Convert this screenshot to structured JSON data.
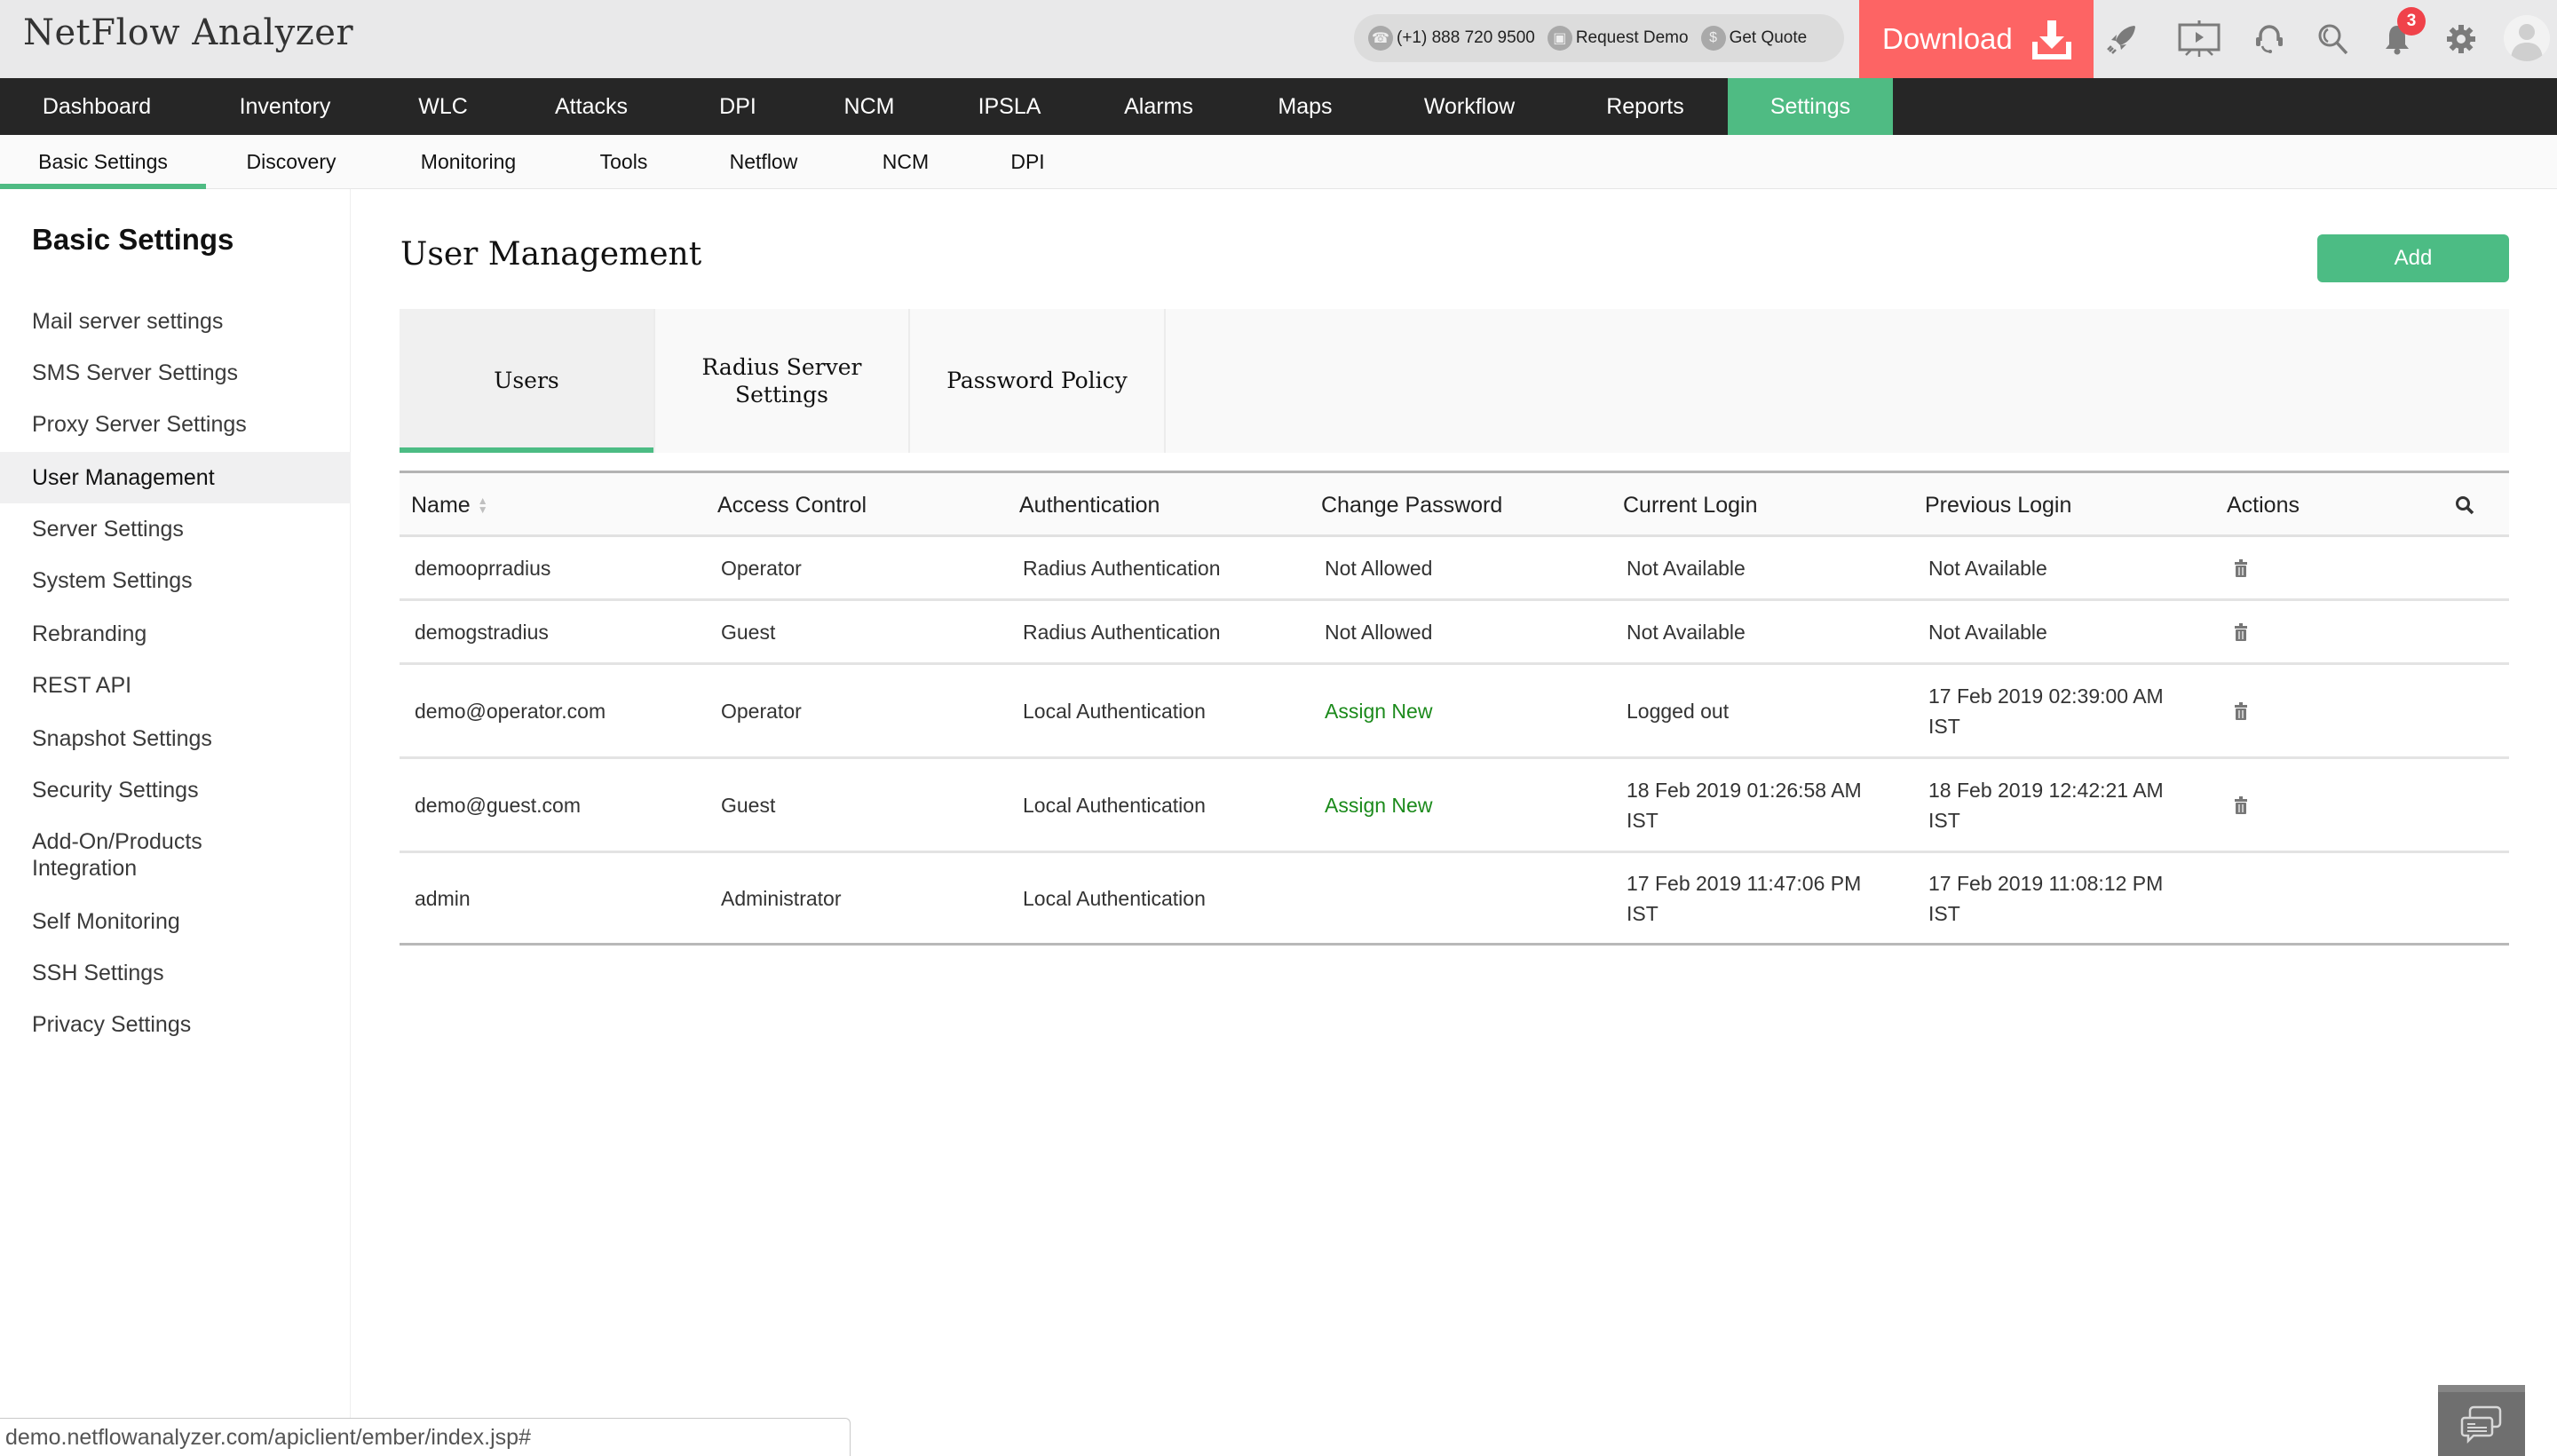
{
  "header": {
    "app_title": "NetFlow Analyzer",
    "phone": "(+1) 888 720 9500",
    "request_demo": "Request Demo",
    "get_quote": "Get Quote",
    "download_label": "Download",
    "notification_count": "3",
    "icons": [
      "rocket-icon",
      "demo-presentation-icon",
      "headset-support-icon",
      "search-icon",
      "bell-icon",
      "gear-icon",
      "user-avatar-icon"
    ],
    "colors": {
      "download_bg": "#fd6464",
      "accent": "#4fbb83"
    }
  },
  "main_nav": {
    "items": [
      {
        "label": "Dashboard"
      },
      {
        "label": "Inventory"
      },
      {
        "label": "WLC"
      },
      {
        "label": "Attacks"
      },
      {
        "label": "DPI"
      },
      {
        "label": "NCM"
      },
      {
        "label": "IPSLA"
      },
      {
        "label": "Alarms"
      },
      {
        "label": "Maps"
      },
      {
        "label": "Workflow"
      },
      {
        "label": "Reports"
      },
      {
        "label": "Settings"
      }
    ],
    "active": "Settings"
  },
  "sub_nav": {
    "items": [
      {
        "label": "Basic Settings"
      },
      {
        "label": "Discovery"
      },
      {
        "label": "Monitoring"
      },
      {
        "label": "Tools"
      },
      {
        "label": "Netflow"
      },
      {
        "label": "NCM"
      },
      {
        "label": "DPI"
      }
    ],
    "active": "Basic Settings"
  },
  "sidebar": {
    "title": "Basic Settings",
    "items": [
      {
        "label": "Mail server settings"
      },
      {
        "label": "SMS Server Settings"
      },
      {
        "label": "Proxy Server Settings"
      },
      {
        "label": "User Management"
      },
      {
        "label": "Server Settings"
      },
      {
        "label": "System Settings"
      },
      {
        "label": "Rebranding"
      },
      {
        "label": "REST API"
      },
      {
        "label": "Snapshot Settings"
      },
      {
        "label": "Security Settings"
      },
      {
        "label": "Add-On/Products Integration"
      },
      {
        "label": "Self Monitoring"
      },
      {
        "label": "SSH Settings"
      },
      {
        "label": "Privacy Settings"
      }
    ],
    "active": "User Management"
  },
  "content": {
    "title": "User Management",
    "add_label": "Add",
    "tabs": [
      {
        "label": "Users"
      },
      {
        "label": "Radius Server Settings"
      },
      {
        "label": "Password Policy"
      }
    ],
    "active_tab": "Users"
  },
  "table": {
    "columns": [
      "Name",
      "Access Control",
      "Authentication",
      "Change Password",
      "Current Login",
      "Previous Login",
      "Actions"
    ],
    "rows": [
      {
        "name": "demooprradius",
        "access": "Operator",
        "auth": "Radius Authentication",
        "change_password": "Not Allowed",
        "change_password_link": false,
        "current_login": "Not Available",
        "previous_login": "Not Available",
        "deletable": true
      },
      {
        "name": "demogstradius",
        "access": "Guest",
        "auth": "Radius Authentication",
        "change_password": "Not Allowed",
        "change_password_link": false,
        "current_login": "Not Available",
        "previous_login": "Not Available",
        "deletable": true
      },
      {
        "name": "demo@operator.com",
        "access": "Operator",
        "auth": "Local Authentication",
        "change_password": "Assign New",
        "change_password_link": true,
        "current_login": "Logged out",
        "previous_login": "17 Feb 2019 02:39:00 AM IST",
        "deletable": true
      },
      {
        "name": "demo@guest.com",
        "access": "Guest",
        "auth": "Local Authentication",
        "change_password": "Assign New",
        "change_password_link": true,
        "current_login": "18 Feb 2019 01:26:58 AM IST",
        "previous_login": "18 Feb 2019 12:42:21 AM IST",
        "deletable": true
      },
      {
        "name": "admin",
        "access": "Administrator",
        "auth": "Local Authentication",
        "change_password": "",
        "change_password_link": false,
        "current_login": "17 Feb 2019 11:47:06 PM IST",
        "previous_login": "17 Feb 2019 11:08:12 PM IST",
        "deletable": false
      }
    ]
  },
  "status_bar": {
    "url": "demo.netflowanalyzer.com/apiclient/ember/index.jsp#"
  }
}
